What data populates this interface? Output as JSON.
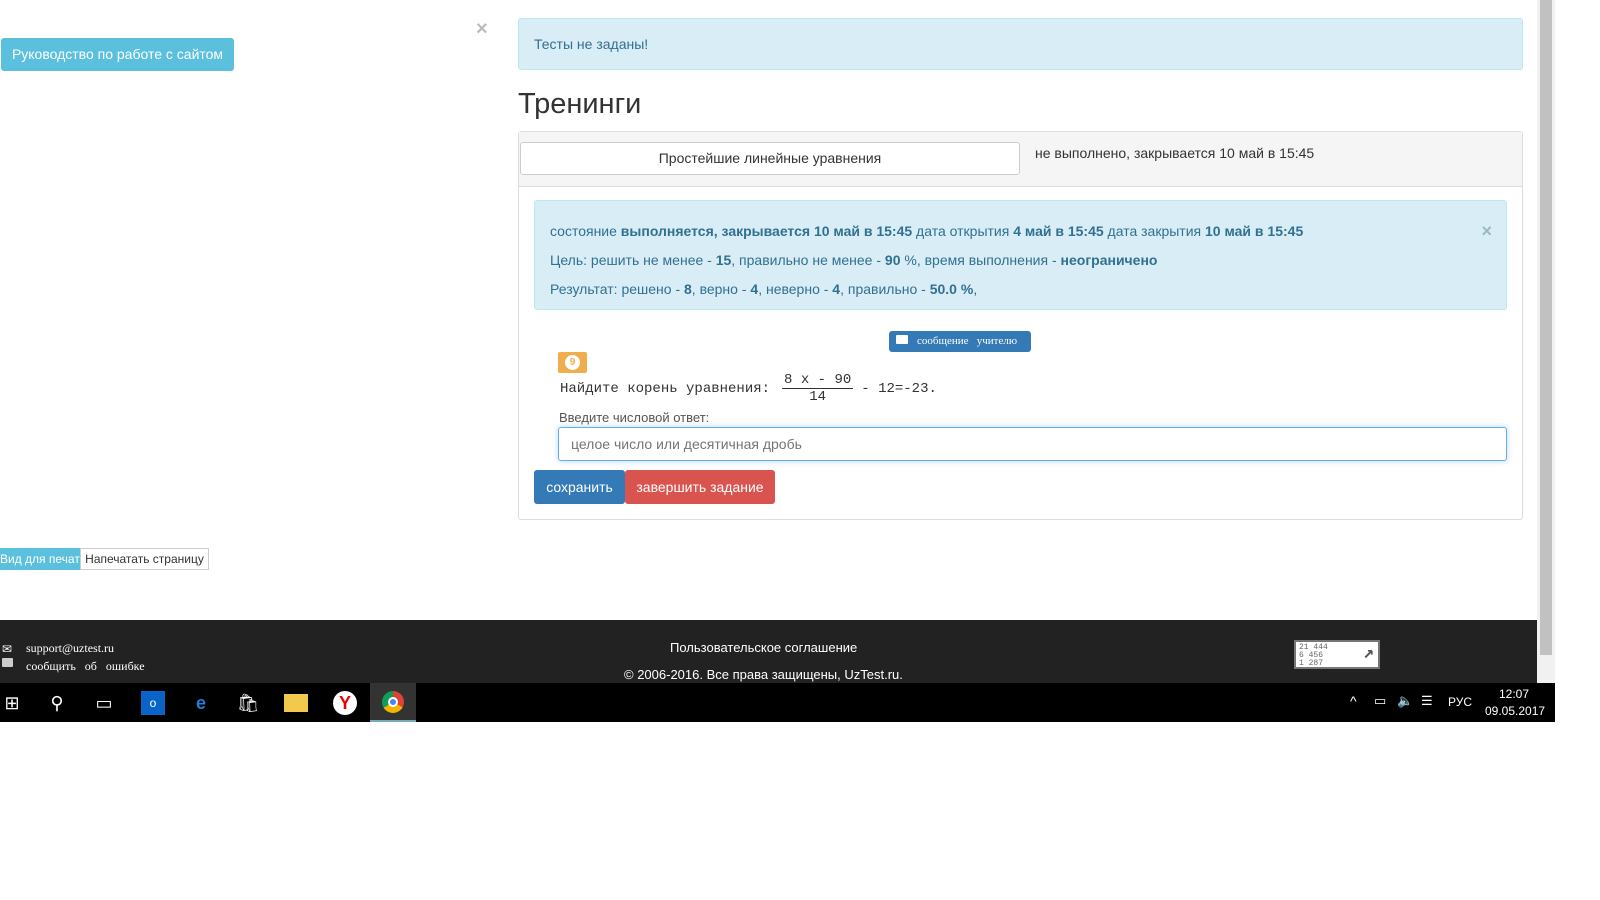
{
  "guide_button": "Руководство по работе с сайтом",
  "close_symbol": "×",
  "alert_top": "Тесты не заданы!",
  "page_title": "Тренинги",
  "training": {
    "topic": "Простейшие линейные уравнения",
    "status": "не выполнено, закрывается 10 май в 15:45"
  },
  "info": {
    "l1": [
      "состояние ",
      "выполняется, закрывается 10 май в 15:45",
      " дата открытия ",
      "4 май в 15:45",
      " дата закрытия ",
      "10 май в 15:45"
    ],
    "l2": [
      "Цель: решить не менее - ",
      "15",
      ", правильно не менее - ",
      "90",
      " %, время выполнения - ",
      "неограничено"
    ],
    "l3": [
      "Результат: решено - ",
      "8",
      ", верно - ",
      "4",
      ", неверно - ",
      "4",
      ", правильно - ",
      "50.0 %",
      ","
    ]
  },
  "message_button": "сообщение   учителю",
  "task": {
    "number": "9",
    "prompt": "Найдите корень уравнения:",
    "numerator": "8 x - 90",
    "denominator": "14",
    "rest": "- 12=-23."
  },
  "answer_label": "Введите числовой ответ:",
  "answer_placeholder": "целое число или десятичная дробь",
  "save_button": "сохранить",
  "finish_button": "завершить задание",
  "print_view": "Вид для печати",
  "print_page": "Напечатать страницу",
  "footer": {
    "email": "support@uztest.ru",
    "report": "сообщить   об   ошибке",
    "agreement": "Пользовательское соглашение",
    "copyright": "© 2006-2016. Все права защищены, UzTest.ru.",
    "counter": [
      "21 444",
      "6 456",
      "1 287"
    ]
  },
  "taskbar": {
    "lang": "РУС",
    "time": "12:07",
    "date": "09.05.2017"
  }
}
